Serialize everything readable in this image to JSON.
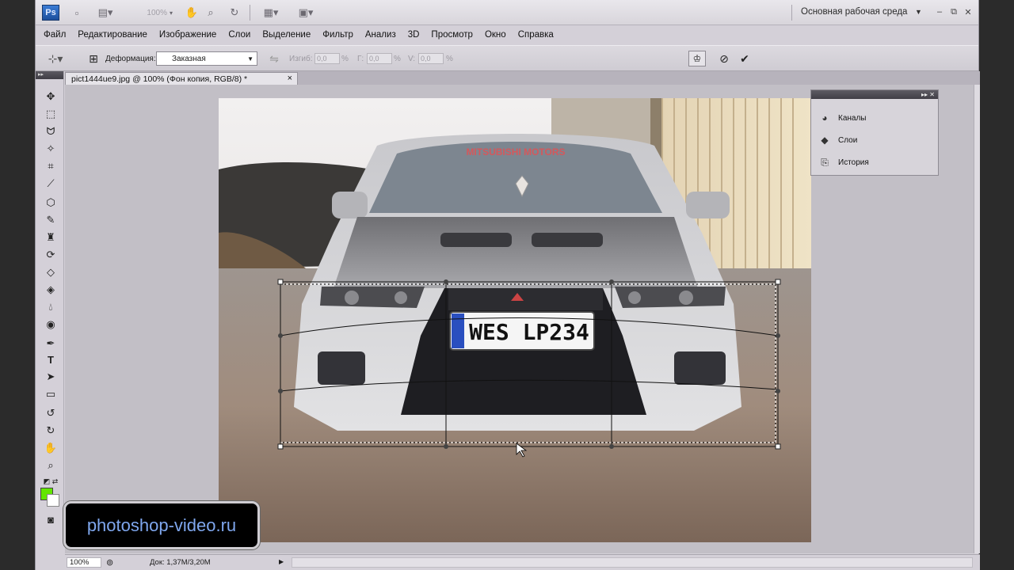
{
  "app": {
    "logo": "Ps",
    "zoom_display": "100%",
    "workspace": "Основная рабочая среда"
  },
  "menu": [
    "Файл",
    "Редактирование",
    "Изображение",
    "Слои",
    "Выделение",
    "Фильтр",
    "Анализ",
    "3D",
    "Просмотр",
    "Окно",
    "Справка"
  ],
  "options": {
    "warp_label": "Деформация:",
    "warp_value": "Заказная",
    "bend_label": "Изгиб:",
    "bend_value": "0,0",
    "h_label": "Г:",
    "h_value": "0,0",
    "v_label": "V:",
    "v_value": "0,0",
    "percent": "%"
  },
  "document": {
    "tab_title": "pict1444ue9.jpg @ 100% (Фон копия, RGB/8) *",
    "close": "×"
  },
  "plate_text": "WES LP234",
  "banner_text": "MITSUBISHI MOTORS",
  "panel": {
    "items": [
      {
        "label": "Каналы",
        "icon": "channels-icon"
      },
      {
        "label": "Слои",
        "icon": "layers-icon"
      },
      {
        "label": "История",
        "icon": "history-icon"
      }
    ]
  },
  "status": {
    "zoom": "100%",
    "doc": "Док: 1,37M/3,20M"
  },
  "watermark": "photoshop-video.ru",
  "colors": {
    "foreground": "#62e600",
    "background": "#ffffff"
  }
}
